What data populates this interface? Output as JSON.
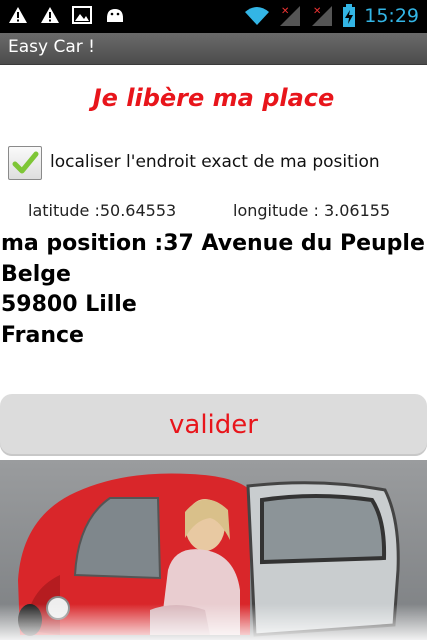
{
  "status_bar": {
    "time": "15:29",
    "left_icons": [
      "warning-icon",
      "warning-icon",
      "image-icon",
      "android-icon"
    ],
    "right_icons": [
      "wifi-icon",
      "signal-no-service-icon",
      "signal-no-service-icon",
      "battery-charging-icon"
    ]
  },
  "title_bar": {
    "title": "Easy Car !"
  },
  "main": {
    "heading": "Je libère ma place",
    "locate_checkbox": {
      "label": "localiser l'endroit exact de ma position",
      "checked": true
    },
    "latitude": "latitude :50.64553",
    "longitude": "longitude : 3.06155",
    "position_lines": [
      "ma position :37 Avenue du Peuple",
      "Belge",
      "59800 Lille",
      "France"
    ],
    "validate_label": "valider"
  },
  "colors": {
    "accent_red": "#e8151b",
    "clock_blue": "#33b5e5",
    "button_gray": "#dcdcdc"
  }
}
